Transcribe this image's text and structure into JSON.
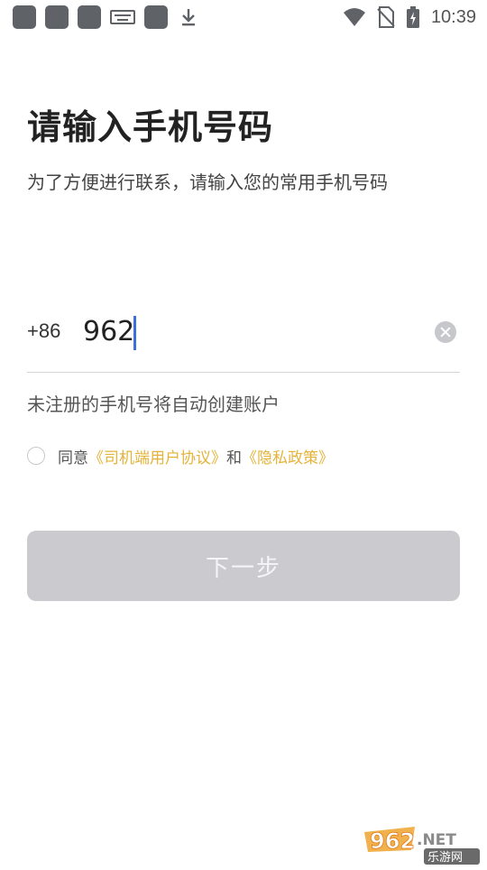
{
  "status_bar": {
    "time": "10:39",
    "icons": [
      "notification-square-icon",
      "notification-square-icon",
      "notification-square-icon",
      "keyboard-icon",
      "notification-square-icon",
      "download-icon",
      "wifi-icon",
      "no-sim-icon",
      "battery-charging-icon"
    ]
  },
  "page": {
    "title": "请输入手机号码",
    "subtitle": "为了方便进行联系，请输入您的常用手机号码"
  },
  "phone": {
    "country_code": "+86",
    "value": "962"
  },
  "hint": "未注册的手机号将自动创建账户",
  "agreement": {
    "prefix": "同意",
    "link1": "《司机端用户协议》",
    "connector": "和",
    "link2": "《隐私政策》",
    "link_color": "#e4b33a"
  },
  "next_button": {
    "label": "下一步",
    "disabled_color": "#cbcbcf"
  },
  "watermark": {
    "brand": "962",
    "suffix": ".NET",
    "sub": "乐游网"
  }
}
